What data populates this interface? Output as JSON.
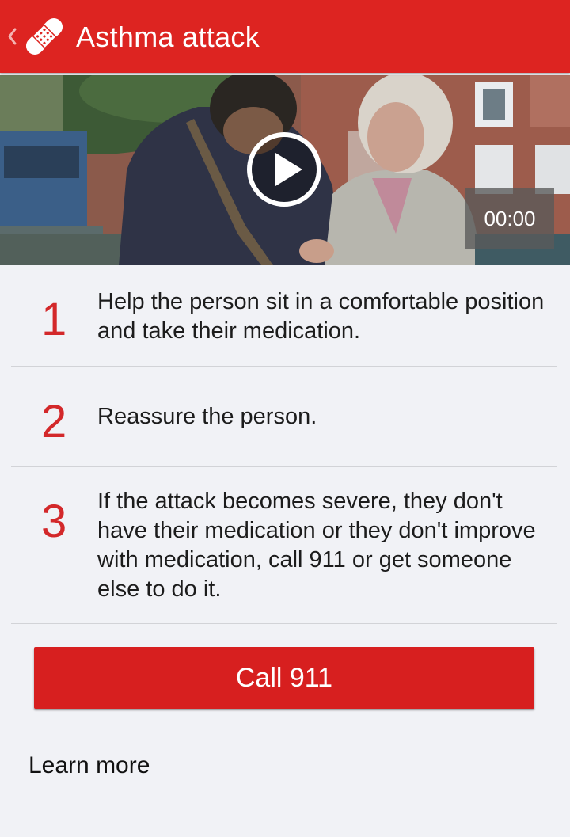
{
  "header": {
    "title": "Asthma attack",
    "back_icon": "chevron-left-icon",
    "app_icon": "bandage-icon",
    "background_color": "#dd2421"
  },
  "video": {
    "play_icon": "play-icon",
    "time": "00:00"
  },
  "steps": [
    {
      "number": "1",
      "text": "Help the person sit in a comfortable position and take their medication."
    },
    {
      "number": "2",
      "text": "Reassure the person."
    },
    {
      "number": "3",
      "text": "If the attack becomes severe, they don't have their medication or they don't improve with medication, call 911 or get someone else to do it."
    }
  ],
  "call_button": {
    "label": "Call 911",
    "color": "#d71f1f"
  },
  "learn_more": {
    "label": "Learn more"
  },
  "colors": {
    "accent": "#d3282a",
    "background": "#f1f2f6"
  }
}
